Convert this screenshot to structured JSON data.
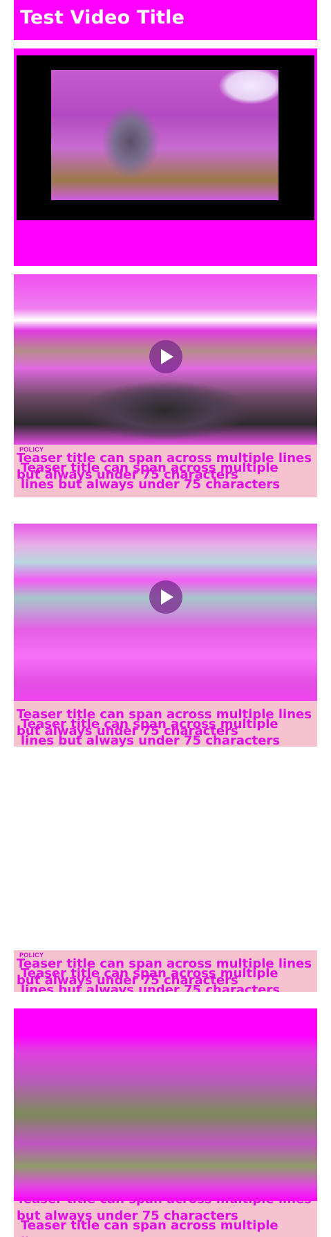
{
  "header": {
    "title": "Test Video Title"
  },
  "video": {
    "caption": "",
    "play_icon": "play-icon"
  },
  "teasers": [
    {
      "tag": "POLICY",
      "title": "Teaser title can span across multiple lines but always under 75 characters",
      "title_repeat": "Teaser title can span across multiple lines but always under 75 characters",
      "image": "coastal-rocks-beach",
      "has_play": true
    },
    {
      "tag": "",
      "title": "Teaser title can span across multiple lines but always under 75 characters",
      "title_repeat": "Teaser title can span across multiple lines but always under 75 characters",
      "image": "sea-sky-horizon",
      "has_play": true
    },
    {
      "tag": "POLICY",
      "title": "Teaser title can span across multiple lines but always under 75 characters",
      "title_repeat": "Teaser title can span across multiple lines but always under 75 characters",
      "image": "field-path-trees",
      "has_play": false
    },
    {
      "tag": "",
      "title": "Teaser title can span across multiple lines but always under 75 characters",
      "title_repeat": "Teaser title can span across multiple lines",
      "image": "meadow-grass",
      "has_play": false
    }
  ],
  "colors": {
    "accent": "#ff00ff",
    "teaser_bg": "#f6c2cf",
    "title_text": "#e10ee1"
  }
}
